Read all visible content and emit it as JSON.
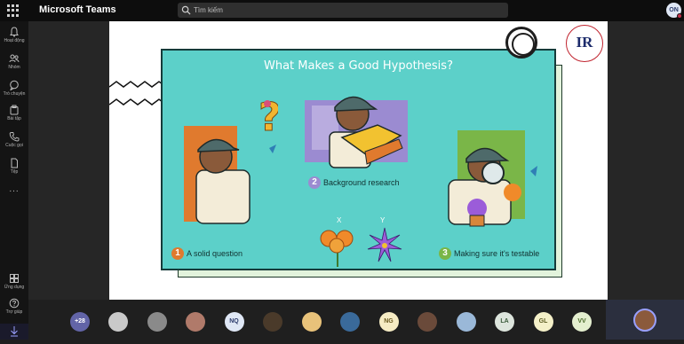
{
  "app": {
    "title": "Microsoft Teams"
  },
  "search": {
    "placeholder": "Tìm kiếm",
    "icon": "search-icon"
  },
  "user": {
    "initials": "ON",
    "status_color": "#c4314b"
  },
  "rail": {
    "items": [
      {
        "label": "Hoạt động",
        "icon": "bell-icon"
      },
      {
        "label": "Nhóm",
        "icon": "teams-icon"
      },
      {
        "label": "Trò chuyện",
        "icon": "chat-icon"
      },
      {
        "label": "Bài tập",
        "icon": "assignment-icon"
      },
      {
        "label": "Cuộc gọi",
        "icon": "phone-icon"
      },
      {
        "label": "Tệp",
        "icon": "file-icon"
      }
    ],
    "more_label": "...",
    "bottom_items": [
      {
        "label": "Ứng dụng",
        "icon": "apps-icon"
      },
      {
        "label": "Trợ giúp",
        "icon": "help-icon"
      }
    ],
    "download_icon": "download-icon"
  },
  "slide": {
    "logo_text": "IR",
    "poster": {
      "title": "What Makes a Good Hypothesis?",
      "steps": [
        {
          "num": "1",
          "label": "A solid question",
          "color": "#e07a2e"
        },
        {
          "num": "2",
          "label": "Background research",
          "color": "#9b8bd1"
        },
        {
          "num": "3",
          "label": "Making sure it's testable",
          "color": "#7ab648"
        }
      ],
      "x_label": "X",
      "y_label": "Y",
      "accent": "#5cd0c9"
    }
  },
  "participants": {
    "overflow": "+28",
    "people": [
      {
        "initials": "",
        "kind": "photo",
        "bg": "#c9c9c9"
      },
      {
        "initials": "",
        "kind": "photo",
        "bg": "#8a8a8a"
      },
      {
        "initials": "",
        "kind": "photo",
        "bg": "#b07a6a"
      },
      {
        "initials": "NQ",
        "kind": "initials",
        "bg": "#dfe7f5",
        "fg": "#2b3a6b"
      },
      {
        "initials": "",
        "kind": "photo",
        "bg": "#4a3a2a"
      },
      {
        "initials": "",
        "kind": "photo",
        "bg": "#e8c27a"
      },
      {
        "initials": "",
        "kind": "photo",
        "bg": "#3a6a9a"
      },
      {
        "initials": "NG",
        "kind": "initials",
        "bg": "#f6ecc4",
        "fg": "#6a5a20"
      },
      {
        "initials": "",
        "kind": "photo",
        "bg": "#6a4a3a"
      },
      {
        "initials": "",
        "kind": "photo",
        "bg": "#9ab8d8"
      },
      {
        "initials": "LA",
        "kind": "initials",
        "bg": "#dde5dd",
        "fg": "#3a5a3a"
      },
      {
        "initials": "GL",
        "kind": "initials",
        "bg": "#f4f0c8",
        "fg": "#5a5a20"
      },
      {
        "initials": "VV",
        "kind": "initials",
        "bg": "#e4efcf",
        "fg": "#4a6a2a"
      }
    ]
  }
}
